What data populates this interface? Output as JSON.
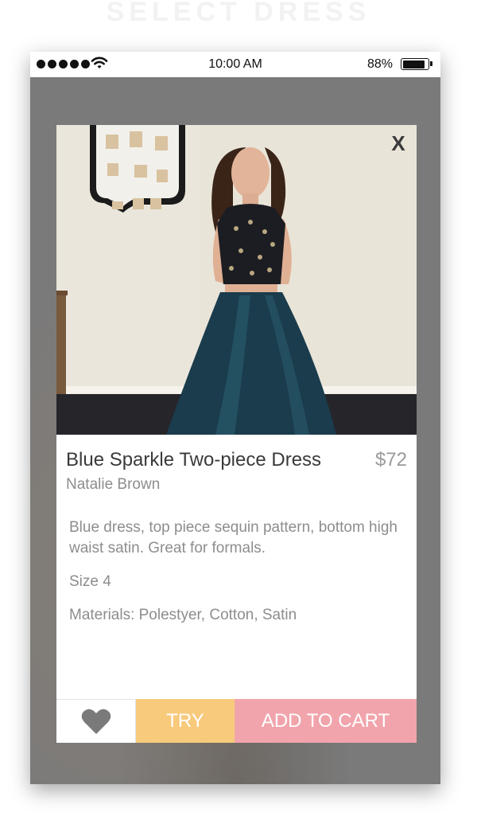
{
  "screen_heading": "SELECT DRESS",
  "status_bar": {
    "time": "10:00 AM",
    "battery": "88%",
    "battery_level": 0.88
  },
  "modal": {
    "close_label": "X",
    "photo_icon": "dress-photo",
    "product": {
      "title": "Blue Sparkle Two-piece Dress",
      "price": "$72",
      "seller": "Natalie Brown",
      "description": "Blue dress, top piece sequin pattern, bottom high waist satin. Great for formals.",
      "size": "Size 4",
      "materials": "Materials: Polestyer, Cotton, Satin"
    },
    "actions": {
      "like_icon": "heart-icon",
      "try_label": "TRY",
      "cart_label": "ADD TO CART"
    }
  },
  "colors": {
    "try": "#f8ca7c",
    "cart": "#f1a4ac",
    "heart": "#7a7a7a",
    "overlay": "#7c7c7c"
  }
}
